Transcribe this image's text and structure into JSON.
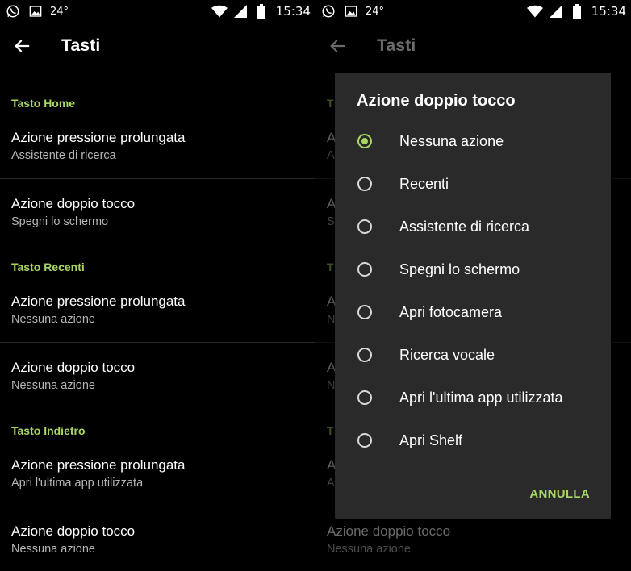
{
  "colors": {
    "background": "#000000",
    "accent": "#a8d664",
    "dialog_bg": "#2a2a2a",
    "subtitle": "#b5b5b5"
  },
  "status_bar": {
    "temperature": "24°",
    "time": "15:34",
    "icons": [
      "whatsapp-icon",
      "image-icon",
      "wifi-icon",
      "signal-icon",
      "battery-icon"
    ]
  },
  "settings_screen": {
    "title": "Tasti",
    "sections": [
      {
        "header": "Tasto Home",
        "items": [
          {
            "title": "Azione pressione prolungata",
            "subtitle": "Assistente di ricerca"
          },
          {
            "title": "Azione doppio tocco",
            "subtitle": "Spegni lo schermo"
          }
        ]
      },
      {
        "header": "Tasto Recenti",
        "items": [
          {
            "title": "Azione pressione prolungata",
            "subtitle": "Nessuna azione"
          },
          {
            "title": "Azione doppio tocco",
            "subtitle": "Nessuna azione"
          }
        ]
      },
      {
        "header": "Tasto Indietro",
        "items": [
          {
            "title": "Azione pressione prolungata",
            "subtitle": "Apri l'ultima app utilizzata"
          },
          {
            "title": "Azione doppio tocco",
            "subtitle": "Nessuna azione"
          }
        ]
      }
    ]
  },
  "background_partial": {
    "a": "A",
    "n": "N",
    "s": "S",
    "t": "T"
  },
  "dialog": {
    "title": "Azione doppio tocco",
    "selected_index": 0,
    "options": [
      "Nessuna azione",
      "Recenti",
      "Assistente di ricerca",
      "Spegni lo schermo",
      "Apri fotocamera",
      "Ricerca vocale",
      "Apri l'ultima app utilizzata",
      "Apri Shelf"
    ],
    "cancel_label": "ANNULLA"
  }
}
